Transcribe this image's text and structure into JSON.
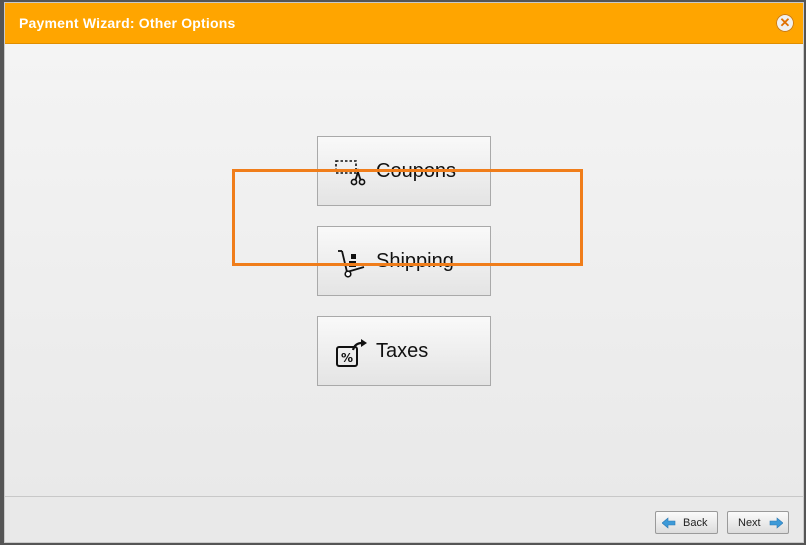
{
  "dialog": {
    "title": "Payment Wizard: Other Options",
    "close_icon": "close-icon"
  },
  "options": [
    {
      "label": "Coupons",
      "icon": "coupon-scissors-icon"
    },
    {
      "label": "Shipping",
      "icon": "hand-truck-icon"
    },
    {
      "label": "Taxes",
      "icon": "tax-percent-icon"
    }
  ],
  "highlighted_option": "Shipping",
  "footer": {
    "back_label": "Back",
    "next_label": "Next"
  },
  "colors": {
    "titlebar": "#ffa500",
    "highlight": "#f07d1a",
    "arrow": "#3d9ad8"
  }
}
